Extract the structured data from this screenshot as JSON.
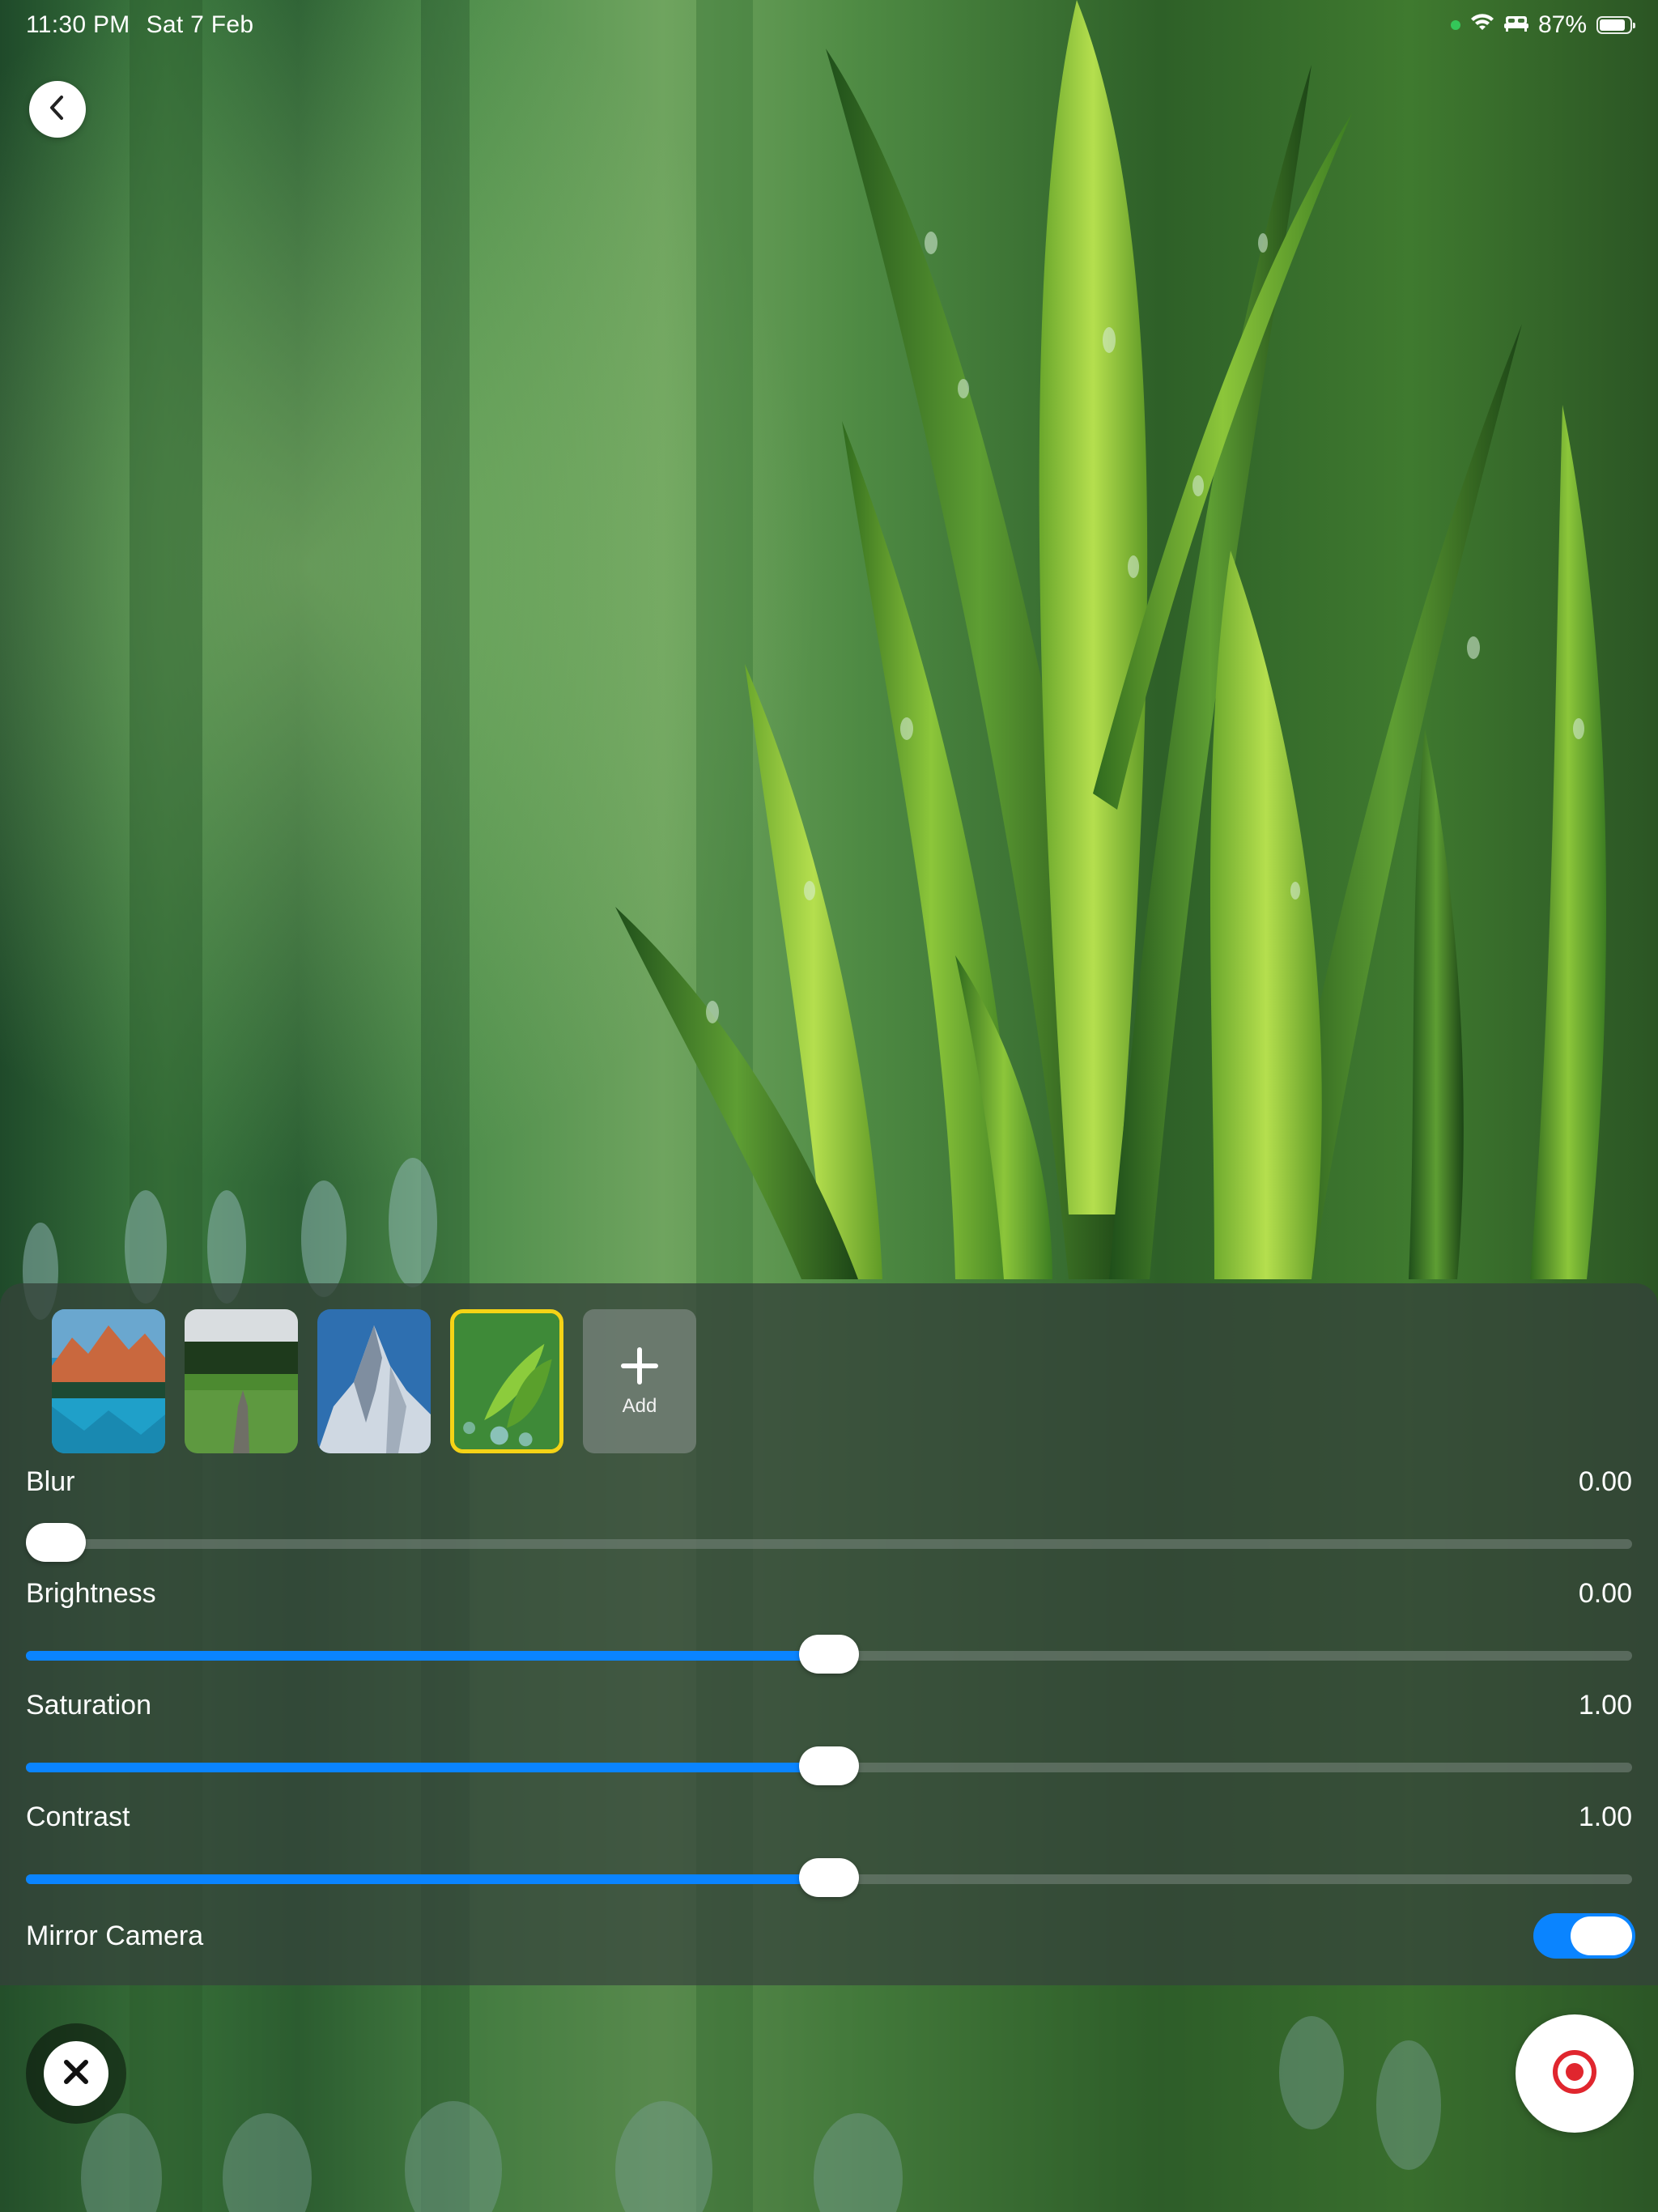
{
  "status_bar": {
    "time": "11:30 PM",
    "date": "Sat 7 Feb",
    "battery_text": "87%",
    "battery_level": 0.87,
    "icons": [
      "green-dot-icon",
      "wifi-icon",
      "sleep-bed-icon",
      "battery-icon"
    ]
  },
  "nav": {
    "back_icon": "chevron-left-icon"
  },
  "backgrounds": {
    "items": [
      {
        "name": "mountain-lake-thumbnail",
        "selected": false
      },
      {
        "name": "green-field-path-thumbnail",
        "selected": false
      },
      {
        "name": "snowy-peak-thumbnail",
        "selected": false
      },
      {
        "name": "green-leaves-thumbnail",
        "selected": true
      }
    ],
    "add_label": "Add",
    "selected_border_color": "#f5d316"
  },
  "adjustments": {
    "blur": {
      "label": "Blur",
      "value": "0.00",
      "level": 0.0
    },
    "brightness": {
      "label": "Brightness",
      "value": "0.00",
      "level": 0.5
    },
    "saturation": {
      "label": "Saturation",
      "value": "1.00",
      "level": 0.5
    },
    "contrast": {
      "label": "Contrast",
      "value": "1.00",
      "level": 0.5
    }
  },
  "mirror": {
    "label": "Mirror Camera",
    "enabled": true
  },
  "actions": {
    "close_icon": "close-x-icon",
    "record_icon": "record-icon"
  },
  "colors": {
    "accent": "#0a84ff",
    "record": "#e0262e",
    "selected": "#f5d316"
  }
}
